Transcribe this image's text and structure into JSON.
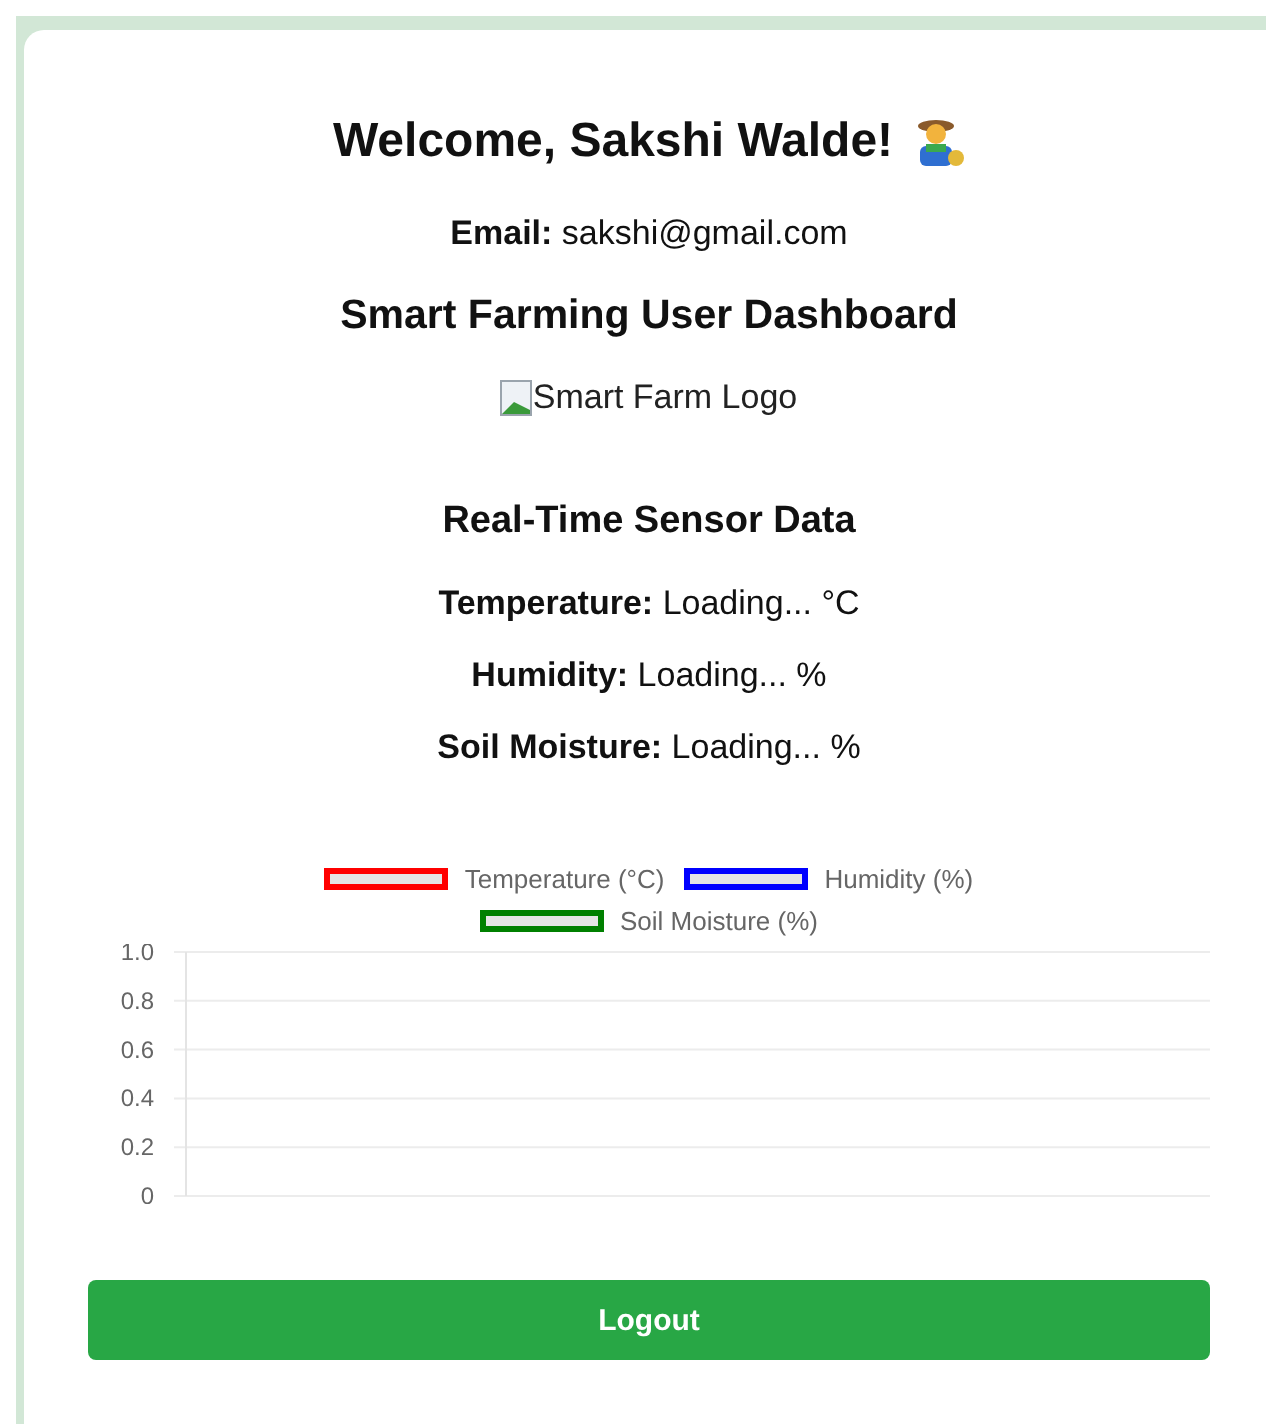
{
  "welcome": {
    "title": "Welcome, Sakshi Walde!"
  },
  "email": "**Email:** sakshi@gmail.com",
  "dashboard_title": "Smart Farming User Dashboard",
  "logo": {
    "alt_text": "Smart Farm Logo"
  },
  "sensor_section": {
    "title": "Real-Time Sensor Data",
    "readings": [
      "**Temperature:** Loading... °C",
      "**Humidity:** Loading... %",
      "**Soil Moisture:** Loading... %"
    ]
  },
  "chart_data": {
    "type": "line",
    "series": [
      {
        "name": "Temperature (°C)",
        "color": "#ff0000"
      },
      {
        "name": "Humidity (%)",
        "color": "#0000ff"
      },
      {
        "name": "Soil Moisture (%)",
        "color": "#008000"
      }
    ],
    "grid": true,
    "ylim": [
      0,
      1
    ],
    "yticks": [
      0,
      0.2,
      0.4,
      0.6,
      0.8,
      {
        "value": 1,
        "label": "1.0"
      }
    ]
  },
  "buttons": [
    {
      "label": "Logout",
      "kind": "primary"
    }
  ]
}
